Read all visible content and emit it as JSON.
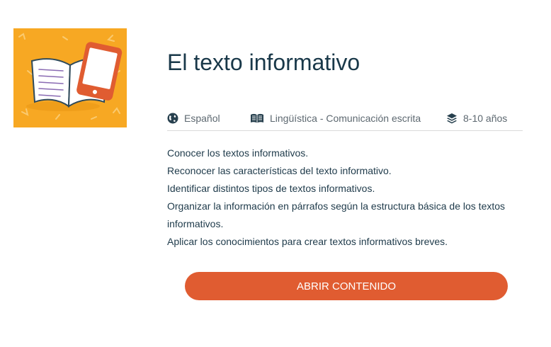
{
  "course": {
    "title": "El texto informativo",
    "meta": {
      "language": {
        "label": "Español",
        "icon": "globe-icon"
      },
      "subject": {
        "label": "Lingüística - Comunicación escrita",
        "icon": "open-book-icon"
      },
      "level": {
        "label": "8-10 años",
        "icon": "layers-icon"
      }
    },
    "objectives": [
      "Conocer los textos informativos.",
      "Reconocer las características del texto informativo.",
      "Identificar distintos tipos de textos informativos.",
      "Organizar la información en párrafos según la estructura básica de los textos informativos.",
      "Aplicar los conocimientos para crear textos informativos breves."
    ],
    "cta_label": "ABRIR CONTENIDO"
  },
  "colors": {
    "thumbnail_bg": "#f7a823",
    "accent": "#e05c31",
    "title": "#193849"
  }
}
